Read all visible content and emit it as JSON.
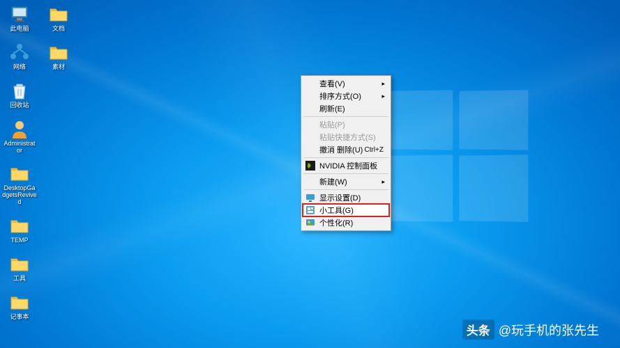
{
  "desktop_icons": {
    "col1": [
      {
        "id": "this-pc",
        "label": "此电脑",
        "glyph": "pc"
      },
      {
        "id": "network",
        "label": "网络",
        "glyph": "network"
      },
      {
        "id": "recycle",
        "label": "回收站",
        "glyph": "recycle"
      },
      {
        "id": "admin",
        "label": "Administrator",
        "glyph": "user"
      },
      {
        "id": "gadgets",
        "label": "DesktopGadgetsRevived",
        "glyph": "folder"
      },
      {
        "id": "temp",
        "label": "TEMP",
        "glyph": "folder"
      },
      {
        "id": "tools",
        "label": "工具",
        "glyph": "folder"
      },
      {
        "id": "notepad",
        "label": "记事本",
        "glyph": "folder"
      }
    ],
    "col2": [
      {
        "id": "docs",
        "label": "文档",
        "glyph": "folder"
      },
      {
        "id": "material",
        "label": "素材",
        "glyph": "folder"
      }
    ]
  },
  "context_menu": {
    "items": [
      {
        "id": "view",
        "label": "查看(V)",
        "arrow": true,
        "disabled": false,
        "icon": "",
        "highlighted": false,
        "shortcut": ""
      },
      {
        "id": "sort",
        "label": "排序方式(O)",
        "arrow": true,
        "disabled": false,
        "icon": "",
        "highlighted": false,
        "shortcut": ""
      },
      {
        "id": "refresh",
        "label": "刷新(E)",
        "arrow": false,
        "disabled": false,
        "icon": "",
        "highlighted": false,
        "shortcut": ""
      },
      {
        "id": "sep1",
        "sep": true
      },
      {
        "id": "paste",
        "label": "粘贴(P)",
        "arrow": false,
        "disabled": true,
        "icon": "",
        "highlighted": false,
        "shortcut": ""
      },
      {
        "id": "paste-sc",
        "label": "粘贴快捷方式(S)",
        "arrow": false,
        "disabled": true,
        "icon": "",
        "highlighted": false,
        "shortcut": ""
      },
      {
        "id": "undo",
        "label": "撤消 删除(U)",
        "arrow": false,
        "disabled": false,
        "icon": "",
        "highlighted": false,
        "shortcut": "Ctrl+Z"
      },
      {
        "id": "sep2",
        "sep": true
      },
      {
        "id": "nvidia",
        "label": "NVIDIA 控制面板",
        "arrow": false,
        "disabled": false,
        "icon": "nvidia",
        "highlighted": false,
        "shortcut": ""
      },
      {
        "id": "sep3",
        "sep": true
      },
      {
        "id": "new",
        "label": "新建(W)",
        "arrow": true,
        "disabled": false,
        "icon": "",
        "highlighted": false,
        "shortcut": ""
      },
      {
        "id": "sep4",
        "sep": true
      },
      {
        "id": "display",
        "label": "显示设置(D)",
        "arrow": false,
        "disabled": false,
        "icon": "display",
        "highlighted": false,
        "shortcut": ""
      },
      {
        "id": "gadgets",
        "label": "小工具(G)",
        "arrow": false,
        "disabled": false,
        "icon": "gadget",
        "highlighted": true,
        "shortcut": ""
      },
      {
        "id": "personalize",
        "label": "个性化(R)",
        "arrow": false,
        "disabled": false,
        "icon": "personal",
        "highlighted": false,
        "shortcut": ""
      }
    ]
  },
  "watermark": {
    "badge": "头条",
    "author": "@玩手机的张先生"
  }
}
